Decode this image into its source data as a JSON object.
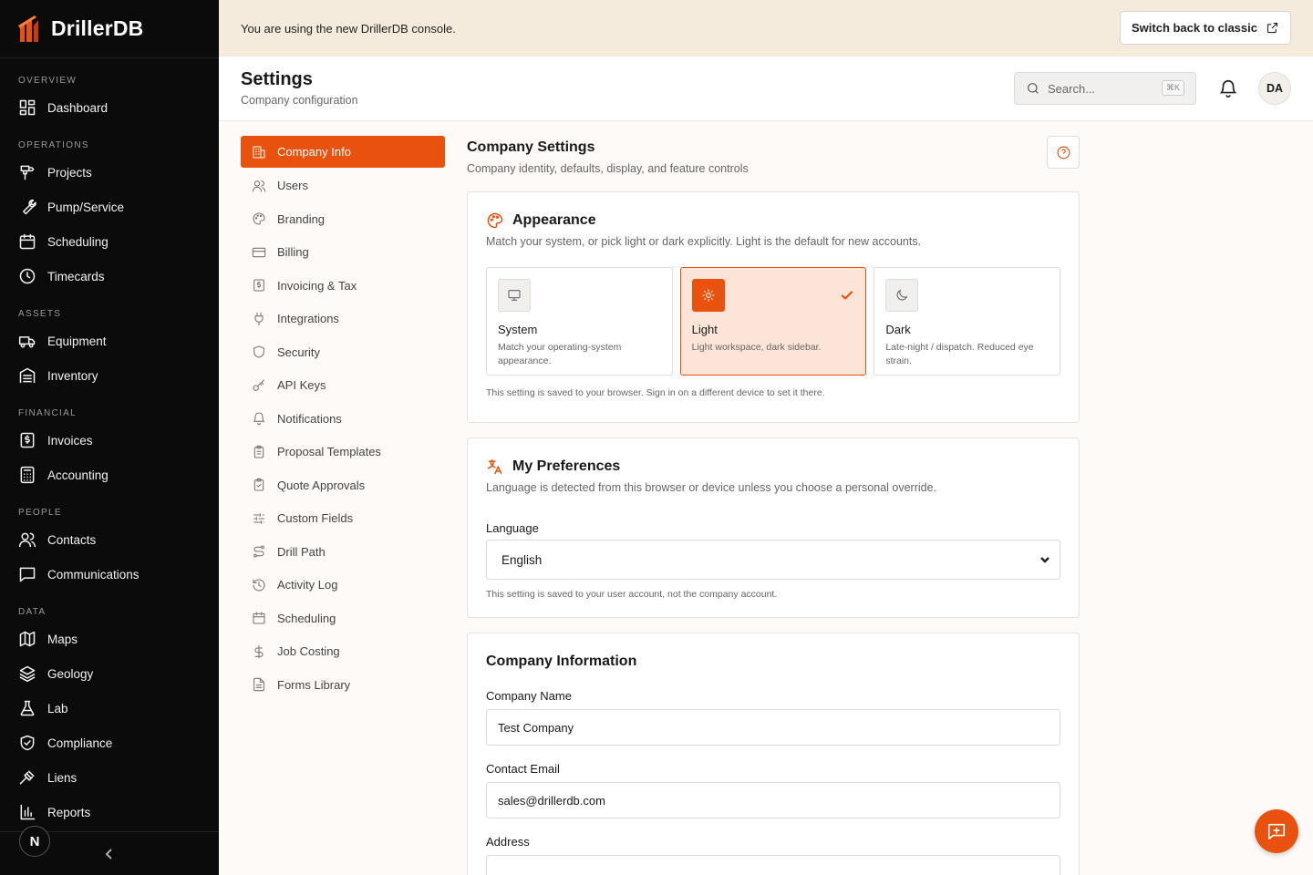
{
  "brand": {
    "name": "DrillerDB",
    "accent": "#e8520e"
  },
  "sidebar": {
    "sections": [
      {
        "label": "OVERVIEW",
        "items": [
          {
            "label": "Dashboard",
            "icon": "dashboard-icon"
          }
        ]
      },
      {
        "label": "OPERATIONS",
        "items": [
          {
            "label": "Projects",
            "icon": "drill-icon"
          },
          {
            "label": "Pump/Service",
            "icon": "wrench-icon"
          },
          {
            "label": "Scheduling",
            "icon": "calendar-icon"
          },
          {
            "label": "Timecards",
            "icon": "clock-icon"
          }
        ]
      },
      {
        "label": "ASSETS",
        "items": [
          {
            "label": "Equipment",
            "icon": "truck-icon"
          },
          {
            "label": "Inventory",
            "icon": "warehouse-icon"
          }
        ]
      },
      {
        "label": "FINANCIAL",
        "items": [
          {
            "label": "Invoices",
            "icon": "invoice-icon"
          },
          {
            "label": "Accounting",
            "icon": "calculator-icon"
          }
        ]
      },
      {
        "label": "PEOPLE",
        "items": [
          {
            "label": "Contacts",
            "icon": "users-icon"
          },
          {
            "label": "Communications",
            "icon": "message-icon"
          }
        ]
      },
      {
        "label": "DATA",
        "items": [
          {
            "label": "Maps",
            "icon": "map-icon"
          },
          {
            "label": "Geology",
            "icon": "layers-icon"
          },
          {
            "label": "Lab",
            "icon": "flask-icon"
          },
          {
            "label": "Compliance",
            "icon": "shield-check-icon"
          },
          {
            "label": "Liens",
            "icon": "gavel-icon"
          },
          {
            "label": "Reports",
            "icon": "bar-chart-icon"
          }
        ]
      }
    ],
    "user_initial": "N"
  },
  "banner": {
    "text": "You are using the new DrillerDB console.",
    "button_label": "Switch back to classic"
  },
  "header": {
    "title": "Settings",
    "subtitle": "Company configuration",
    "search_placeholder": "Search...",
    "shortcut": "⌘K",
    "avatar_initials": "DA"
  },
  "settings_menu": [
    {
      "label": "Company Info",
      "icon": "building-icon",
      "active": true
    },
    {
      "label": "Users",
      "icon": "users-icon"
    },
    {
      "label": "Branding",
      "icon": "palette-icon"
    },
    {
      "label": "Billing",
      "icon": "credit-card-icon"
    },
    {
      "label": "Invoicing & Tax",
      "icon": "receipt-icon"
    },
    {
      "label": "Integrations",
      "icon": "plug-icon"
    },
    {
      "label": "Security",
      "icon": "shield-icon"
    },
    {
      "label": "API Keys",
      "icon": "key-icon"
    },
    {
      "label": "Notifications",
      "icon": "bell-icon"
    },
    {
      "label": "Proposal Templates",
      "icon": "clipboard-icon"
    },
    {
      "label": "Quote Approvals",
      "icon": "clipboard-check-icon"
    },
    {
      "label": "Custom Fields",
      "icon": "sliders-icon"
    },
    {
      "label": "Drill Path",
      "icon": "route-icon"
    },
    {
      "label": "Activity Log",
      "icon": "history-icon"
    },
    {
      "label": "Scheduling",
      "icon": "calendar-icon"
    },
    {
      "label": "Job Costing",
      "icon": "dollar-icon"
    },
    {
      "label": "Forms Library",
      "icon": "file-text-icon"
    }
  ],
  "content": {
    "title": "Company Settings",
    "subtitle": "Company identity, defaults, display, and feature controls",
    "appearance": {
      "title": "Appearance",
      "description": "Match your system, or pick light or dark explicitly. Light is the default for new accounts.",
      "options": [
        {
          "name": "System",
          "description": "Match your operating-system appearance."
        },
        {
          "name": "Light",
          "description": "Light workspace, dark sidebar."
        },
        {
          "name": "Dark",
          "description": "Late-night / dispatch. Reduced eye strain."
        }
      ],
      "selected": "Light",
      "hint": "This setting is saved to your browser. Sign in on a different device to set it there."
    },
    "preferences": {
      "title": "My Preferences",
      "description": "Language is detected from this browser or device unless you choose a personal override.",
      "language_label": "Language",
      "language_value": "English",
      "hint": "This setting is saved to your user account, not the company account."
    },
    "company_info": {
      "title": "Company Information",
      "name_label": "Company Name",
      "name_value": "Test Company",
      "email_label": "Contact Email",
      "email_value": "sales@drillerdb.com",
      "address_label": "Address"
    }
  }
}
